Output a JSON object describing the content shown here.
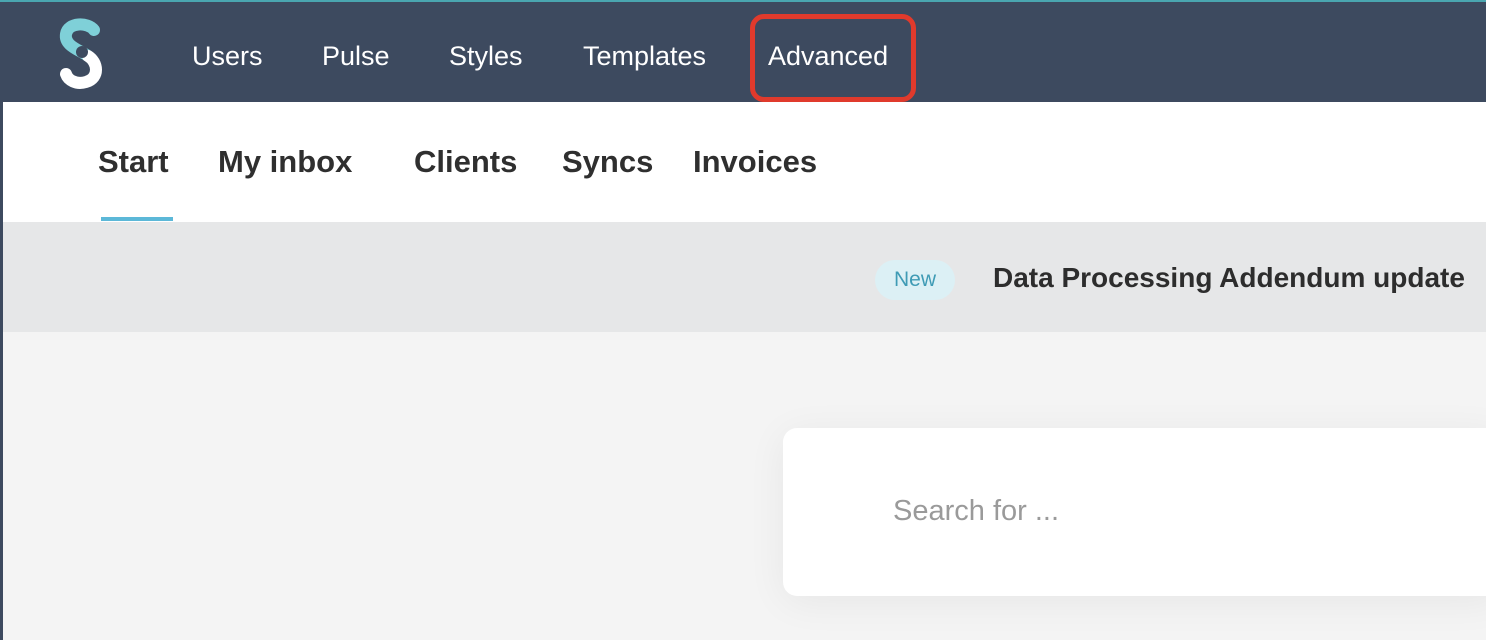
{
  "top_nav": {
    "logo_icon": "s-logo-icon",
    "items": [
      {
        "label": "Users"
      },
      {
        "label": "Pulse"
      },
      {
        "label": "Styles"
      },
      {
        "label": "Templates"
      },
      {
        "label": "Advanced"
      }
    ],
    "highlight_color": "#e03a2c",
    "background": "#3d4a5f"
  },
  "sub_nav": {
    "tabs": [
      {
        "label": "Start",
        "active": true
      },
      {
        "label": "My inbox"
      },
      {
        "label": "Clients"
      },
      {
        "label": "Syncs"
      },
      {
        "label": "Invoices"
      }
    ],
    "active_underline_color": "#5cb8d8"
  },
  "banner": {
    "badge": "New",
    "title": "Data Processing Addendum update"
  },
  "search": {
    "placeholder": "Search for ..."
  }
}
